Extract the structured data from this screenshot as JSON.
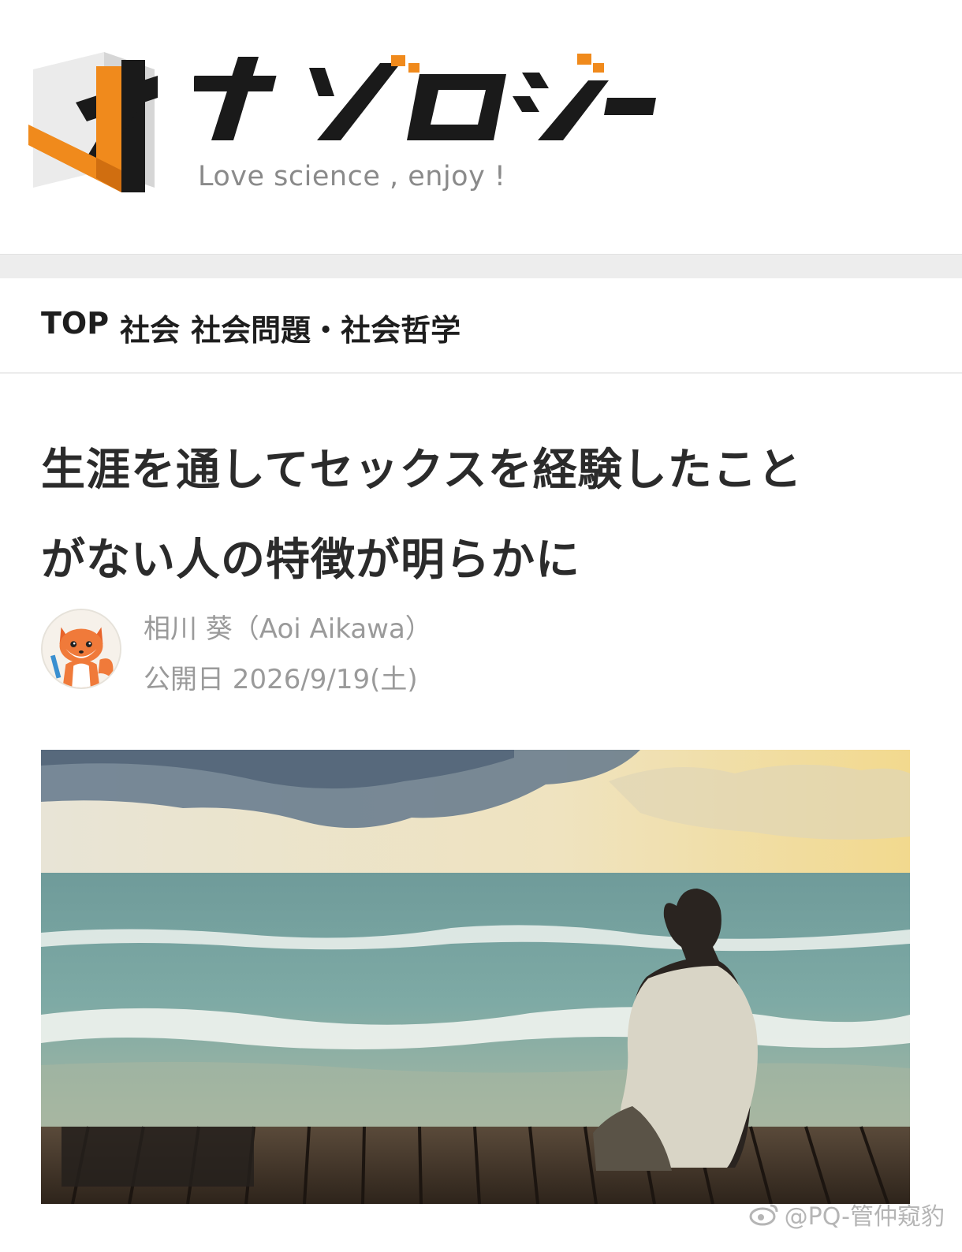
{
  "site": {
    "name": "ナゾロジー",
    "tagline": "Love science , enjoy !",
    "brand_orange": "#f08a1c",
    "brand_black": "#1a1a1a"
  },
  "breadcrumb": {
    "items": [
      "TOP",
      "社会",
      "社会問題・社会哲学"
    ]
  },
  "article": {
    "title_line1": "生涯を通してセックスを経験したこと",
    "title_line2": "がない人の特徴が明らかに",
    "author": "相川 葵（Aoi Aikawa）",
    "date": "公開日 2026/9/19(土)",
    "avatar_icon": "fox-mascot-icon",
    "hero_icon": "man-sitting-on-pier-by-sea-photo"
  },
  "watermark": {
    "text": "@PQ-管仲窥豹",
    "icon": "weibo-icon"
  }
}
